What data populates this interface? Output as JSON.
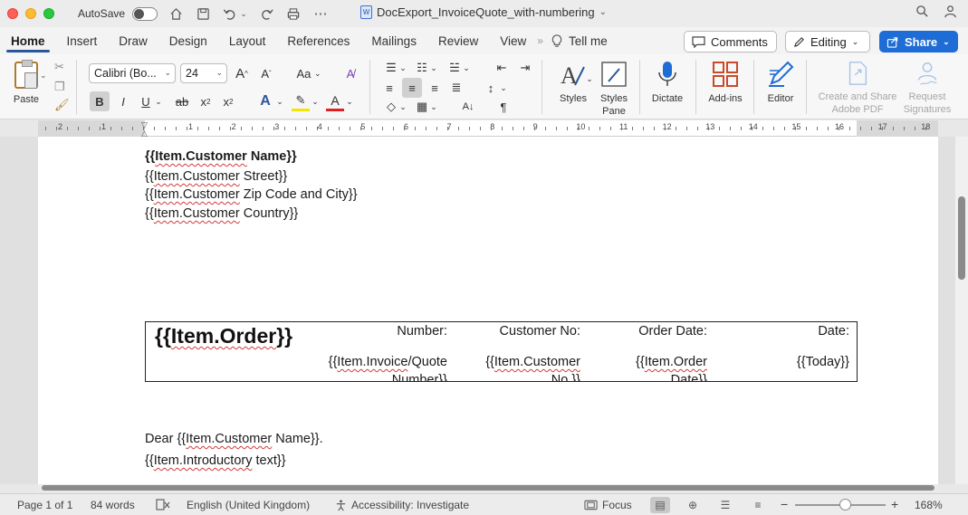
{
  "titlebar": {
    "autosave_label": "AutoSave",
    "document_title": "DocExport_InvoiceQuote_with-numbering",
    "word_icon": "W"
  },
  "tabs": [
    "Home",
    "Insert",
    "Draw",
    "Design",
    "Layout",
    "References",
    "Mailings",
    "Review",
    "View"
  ],
  "tell_me": "Tell me",
  "comments_label": "Comments",
  "editing_label": "Editing",
  "share_label": "Share",
  "ribbon": {
    "paste_label": "Paste",
    "font_name": "Calibri (Bo...",
    "font_size": "24",
    "grow_font": "A",
    "shrink_font": "A",
    "change_case": "Aa",
    "bold": "B",
    "italic": "I",
    "underline": "U",
    "strike": "ab",
    "subscript": "x",
    "superscript": "x",
    "styles_label": "Styles",
    "styles_pane_label_1": "Styles",
    "styles_pane_label_2": "Pane",
    "dictate_label": "Dictate",
    "addins_label": "Add-ins",
    "editor_label": "Editor",
    "adobe_label_1": "Create and Share",
    "adobe_label_2": "Adobe PDF",
    "signatures_label_1": "Request",
    "signatures_label_2": "Signatures"
  },
  "ruler_numbers": [
    "2",
    "1",
    "1",
    "2",
    "3",
    "4",
    "5",
    "6",
    "7",
    "8",
    "9",
    "10",
    "11",
    "12",
    "13",
    "14",
    "15",
    "16",
    "17",
    "18"
  ],
  "document": {
    "address": [
      {
        "pre": "{{",
        "word": "Item.Customer",
        "post": " Name}}"
      },
      {
        "pre": "{{",
        "word": "Item.Customer",
        "post": " Street}}"
      },
      {
        "pre": "{{",
        "word": "Item.Customer",
        "post": " Zip Code and City}}"
      },
      {
        "pre": "{{",
        "word": "Item.Customer",
        "post": " Country}}"
      }
    ],
    "table": {
      "order_pre": "{{",
      "order_word": "Item.Order",
      "order_post": "}}",
      "headers": [
        "Number:",
        "Customer No:",
        "Order Date:",
        "Date:"
      ],
      "values": [
        {
          "pre": "{{",
          "word": "Item.Invoice",
          "post": "/Quote",
          "line2": "Number}}"
        },
        {
          "pre": "{{",
          "word": "Item.Customer",
          "post": "",
          "line2": "No.}}"
        },
        {
          "pre": "{{",
          "word": "Item.Order",
          "post": "",
          "line2": "Date}}"
        },
        {
          "pre": "{{Today}}",
          "word": "",
          "post": "",
          "line2": ""
        }
      ]
    },
    "greeting": {
      "pre": "Dear {{",
      "word": "Item.Customer",
      "post": " Name}}."
    },
    "intro": {
      "pre": "{{",
      "word": "Item.Introductory",
      "post": " text}}"
    }
  },
  "status": {
    "page": "Page 1 of 1",
    "words": "84 words",
    "language": "English (United Kingdom)",
    "accessibility": "Accessibility: Investigate",
    "focus": "Focus",
    "zoom_minus": "−",
    "zoom_plus": "+",
    "zoom": "168%"
  },
  "colors": {
    "accent": "#2b579a",
    "share_button": "#1e6cd5",
    "spellcheck": "#d23b3b"
  }
}
